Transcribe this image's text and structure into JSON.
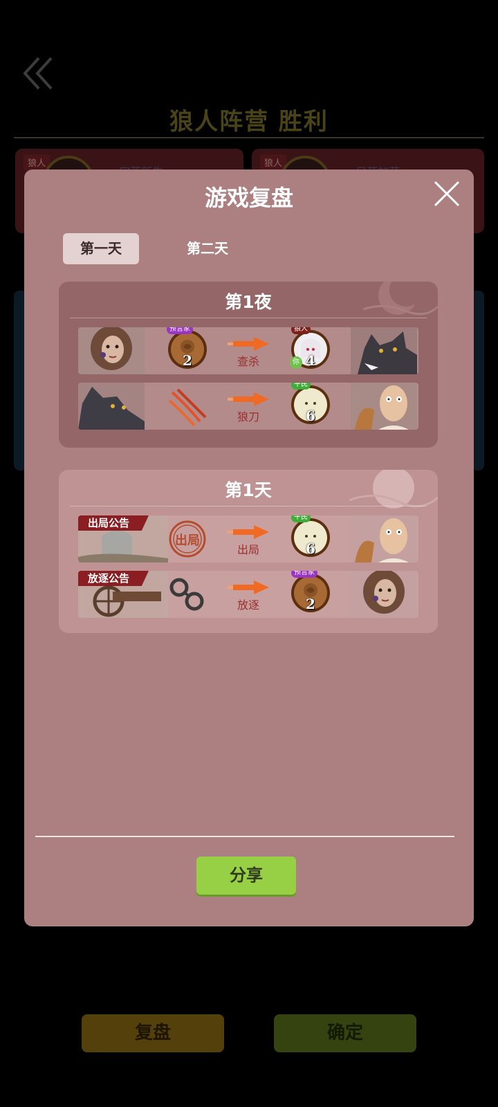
{
  "background": {
    "title": "狼人阵营  胜利",
    "cards": [
      {
        "tag": "狼人",
        "name": "...宗菲新生"
      },
      {
        "tag": "狼人",
        "name": "...只芭加菇"
      }
    ],
    "buttons": {
      "review": "复盘",
      "confirm": "确定"
    }
  },
  "modal": {
    "title": "游戏复盘",
    "tabs": [
      "第一天",
      "第二天"
    ],
    "night": {
      "title": "第1夜",
      "rows": [
        {
          "actor_role": "预言家",
          "actor_number": "2",
          "action": "查杀",
          "target_role": "狼人",
          "target_number": "4",
          "target_you": "你"
        },
        {
          "action": "狼刀",
          "target_role": "平民",
          "target_number": "6"
        }
      ]
    },
    "day": {
      "title": "第1天",
      "rows": [
        {
          "banner": "出局公告",
          "stamp": "出局",
          "action": "出局",
          "target_role": "平民",
          "target_number": "6"
        },
        {
          "banner": "放逐公告",
          "action": "放逐",
          "target_role": "预言家",
          "target_number": "2"
        }
      ]
    },
    "share_label": "分享"
  },
  "colors": {
    "modal_bg": "#ac7f80",
    "share_button": "#98d045",
    "action_text": "#9b2e2e",
    "arrow": "#f06a24"
  }
}
